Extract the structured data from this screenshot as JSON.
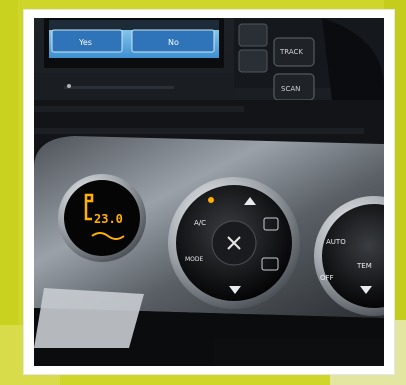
{
  "photo": {
    "subject": "",
    "screen_left_label": "Yes",
    "screen_right_label": "No",
    "screen_top_text": "",
    "button_track": "TRACK",
    "button_scan": "SCAN",
    "climate_display_value": "23.0",
    "ac_label": "A/C",
    "mode_label": "MODE",
    "auto_label": "AUTO",
    "off_label": "OFF",
    "temp_label": "TEM"
  },
  "colors": {
    "accent": "#cfd62a",
    "display_orange": "#ffb000",
    "panel_dark": "#151515",
    "panel_silver": "#8f959b"
  },
  "icons": {
    "fan": "fan-icon",
    "arrow_up": "arrow-up-icon",
    "arrow_down": "arrow-down-icon",
    "defrost": "defrost-icon",
    "recirculate": "recirculate-icon"
  }
}
